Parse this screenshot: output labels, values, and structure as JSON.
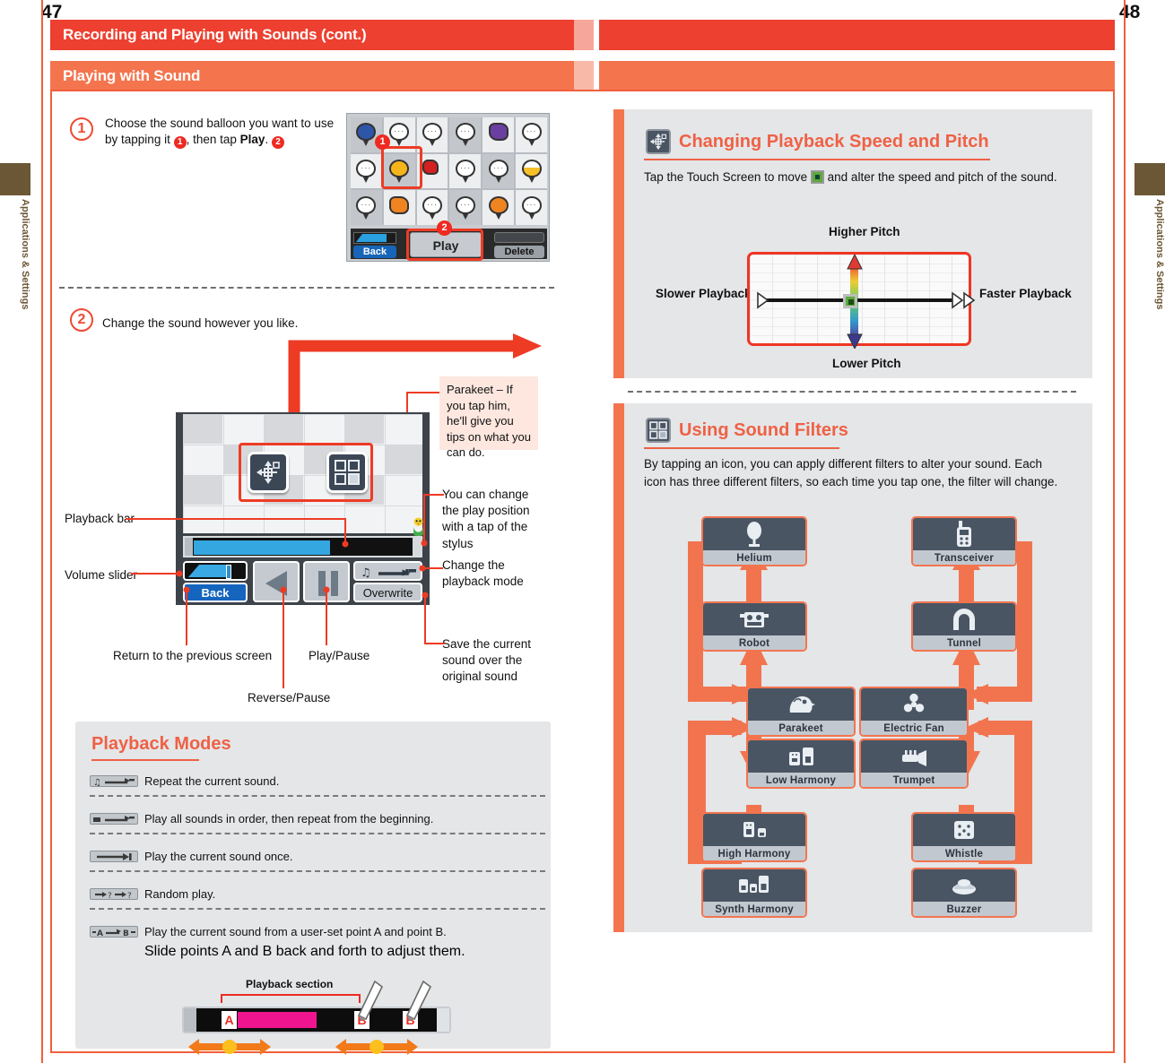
{
  "pages": {
    "left_number": "47",
    "right_number": "48"
  },
  "side_tab": {
    "label": "Applications & Settings"
  },
  "header": {
    "chapter_title": "Recording and Playing with Sounds (cont.)",
    "section_title": "Playing with Sound"
  },
  "colors": {
    "chapter_bar": "#ed4030",
    "section_bar": "#f4744e",
    "accent": "#ef6145",
    "panel_bg": "#e4e6e8",
    "highlight": "#ee3b24"
  },
  "left_page": {
    "step1": {
      "number": "1",
      "text_a": "Choose the sound balloon you want to use by",
      "text_b": "tapping it",
      "marker_1": "1",
      "text_c": ", then tap",
      "bold_word": "Play",
      "text_d": ".",
      "marker_2": "2",
      "screen": {
        "play_button": "Play",
        "back_button": "Back",
        "delete_button": "Delete"
      }
    },
    "step2": {
      "number": "2",
      "text": "Change the sound however you like.",
      "screen": {
        "back_button": "Back",
        "overwrite_button": "Overwrite"
      },
      "callouts": {
        "parakeet_tip": "Parakeet – If you tap him, he'll give you tips on what you can do.",
        "play_position": "You can change the play position with a tap of the stylus",
        "playback_mode": "Change the playback mode",
        "playback_bar": "Playback bar",
        "volume_slider": "Volume slider",
        "return_previous": "Return to the previous screen",
        "play_pause": "Play/Pause",
        "reverse_pause": "Reverse/Pause",
        "overwrite_desc": "Save the current sound over the original sound"
      }
    },
    "playback_modes": {
      "title": "Playback Modes",
      "rows": [
        {
          "icon": "repeat-one-icon",
          "text": "Repeat the current sound."
        },
        {
          "icon": "repeat-all-icon",
          "text": "Play all sounds in order, then repeat from the beginning."
        },
        {
          "icon": "play-once-icon",
          "text": "Play the current sound once."
        },
        {
          "icon": "random-icon",
          "text": "Random play."
        },
        {
          "icon": "ab-repeat-icon",
          "text": "Play the current sound from a user-set point A and point B."
        }
      ],
      "extra_line": "Slide points A and B back and forth to adjust them.",
      "diagram": {
        "section_label": "Playback section",
        "point_a": "A",
        "point_b": "B",
        "point_b2": "B"
      }
    }
  },
  "right_page": {
    "speed_pitch": {
      "icon": "move-crosshair-icon",
      "title": "Changing Playback Speed and Pitch",
      "desc_a": "Tap the Touch Screen to move",
      "marker_icon": "green-marker-icon",
      "desc_b": "and alter the speed and pitch of the sound.",
      "labels": {
        "top": "Higher Pitch",
        "bottom": "Lower Pitch",
        "left": "Slower Playback",
        "right": "Faster Playback"
      }
    },
    "sound_filters": {
      "icon": "four-squares-icon",
      "title": "Using Sound Filters",
      "desc": "By tapping an icon, you can apply different filters to alter your sound. Each icon has three different filters, so each time you tap one, the filter will change.",
      "cards": [
        {
          "id": "helium",
          "label": "Helium",
          "icon": "balloon-icon"
        },
        {
          "id": "transceiver",
          "label": "Transceiver",
          "icon": "walkie-talkie-icon"
        },
        {
          "id": "robot",
          "label": "Robot",
          "icon": "robot-head-icon"
        },
        {
          "id": "tunnel",
          "label": "Tunnel",
          "icon": "tunnel-arch-icon"
        },
        {
          "id": "parakeet",
          "label": "Parakeet",
          "icon": "parakeet-bird-icon"
        },
        {
          "id": "electric-fan",
          "label": "Electric Fan",
          "icon": "fan-blades-icon"
        },
        {
          "id": "low-harmony",
          "label": "Low Harmony",
          "icon": "two-blocks-icon"
        },
        {
          "id": "trumpet",
          "label": "Trumpet",
          "icon": "trumpet-icon"
        },
        {
          "id": "high-harmony",
          "label": "High Harmony",
          "icon": "small-blocks-icon"
        },
        {
          "id": "whistle",
          "label": "Whistle",
          "icon": "whistle-dots-icon"
        },
        {
          "id": "synth-harmony",
          "label": "Synth Harmony",
          "icon": "three-blocks-icon"
        },
        {
          "id": "buzzer",
          "label": "Buzzer",
          "icon": "buzzer-icon"
        }
      ]
    }
  }
}
